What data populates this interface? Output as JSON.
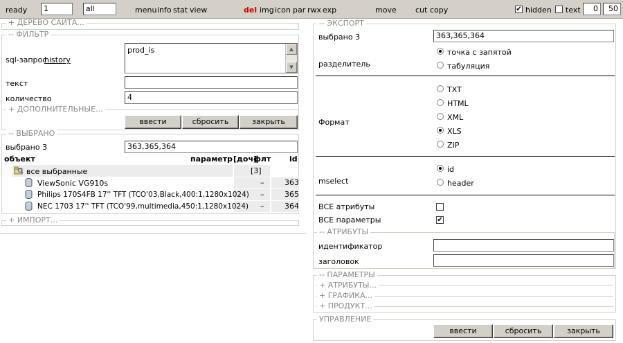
{
  "toolbar": {
    "status": "ready",
    "page_value": "1",
    "filter_value": "all",
    "menu": "menu",
    "info": "info",
    "stat": "stat",
    "view": "view",
    "del": "del",
    "img": "img",
    "icon": "icon",
    "par": "par",
    "rwx": "rwx",
    "exp": "exp",
    "move": "move",
    "cut": "cut",
    "copy": "copy",
    "hidden_label": "hidden",
    "hidden_checked": true,
    "text_label": "text",
    "text_checked": false,
    "from": "0",
    "to": "50",
    "del_color": "#cc0000"
  },
  "left": {
    "site_tree_legend": "+ ДЕРЕВО САЙТА...",
    "filter": {
      "legend": "-- ФИЛЬТР",
      "sql_label": "sql-запрос",
      "history_link": "history",
      "sql_value": "prod_is",
      "text_label": "текст",
      "text_value": "",
      "count_label": "количество",
      "count_value": "4",
      "extra_legend": "+ ДОПОЛНИТЕЛЬНЫЕ...",
      "buttons": [
        "ввести",
        "сбросить",
        "закрыть"
      ]
    },
    "selected": {
      "legend": "-- ВЫБРАНО",
      "label": "выбрано 3",
      "value": "363,365,364",
      "headers": {
        "object": "объект",
        "param": "параметр",
        "doc": "[доч]",
        "flt": "флт",
        "id": "id"
      },
      "all_row": {
        "name": "все выбранные",
        "doc": "[3]"
      },
      "items": [
        {
          "name": "ViewSonic VG910s",
          "flt": "–",
          "id": "363"
        },
        {
          "name": "Philips 170S4FB 17'' TFT (TCO'03,Black,400:1,1280x1024)",
          "flt": "–",
          "id": "365"
        },
        {
          "name": "NEC 1703 17'' TFT (TCO'99,multimedia,450:1,1280x1024)",
          "flt": "–",
          "id": "364"
        }
      ]
    },
    "import_legend": "+ ИМПОРТ..."
  },
  "right": {
    "export": {
      "legend": "-- ЭКСПОРТ",
      "selected_label": "выбрано 3",
      "selected_value": "363,365,364",
      "separator_label": "разделитель",
      "separator_options": [
        {
          "label": "точка с запятой",
          "checked": true
        },
        {
          "label": "табуляция",
          "checked": false
        }
      ],
      "format_label": "Формат",
      "format_options": [
        {
          "label": "TXT",
          "checked": false
        },
        {
          "label": "HTML",
          "checked": false
        },
        {
          "label": "XML",
          "checked": false
        },
        {
          "label": "XLS",
          "checked": true
        },
        {
          "label": "ZIP",
          "checked": false
        }
      ],
      "mselect_label": "mselect",
      "mselect_options": [
        {
          "label": "id",
          "checked": true
        },
        {
          "label": "header",
          "checked": false
        }
      ],
      "all_attrs_label": "ВСЕ атрибуты",
      "all_attrs_checked": false,
      "all_params_label": "ВСЕ параметры",
      "all_params_checked": true,
      "attrs_legend": "-- АТРИБУТЫ",
      "identifier_label": "идентификатор",
      "identifier_value": "",
      "title_label": "заголовок",
      "title_value": ""
    },
    "params_legend": "-- ПАРАМЕТРЫ",
    "attrs2_legend": "+ АТРИБУТЫ...",
    "graphics_legend": "+ ГРАФИКА...",
    "product_legend": "+ ПРОДУКТ...",
    "control": {
      "legend": "УПРАВЛЕНИЕ",
      "buttons": [
        "ввести",
        "сбросить",
        "закрыть"
      ]
    }
  }
}
